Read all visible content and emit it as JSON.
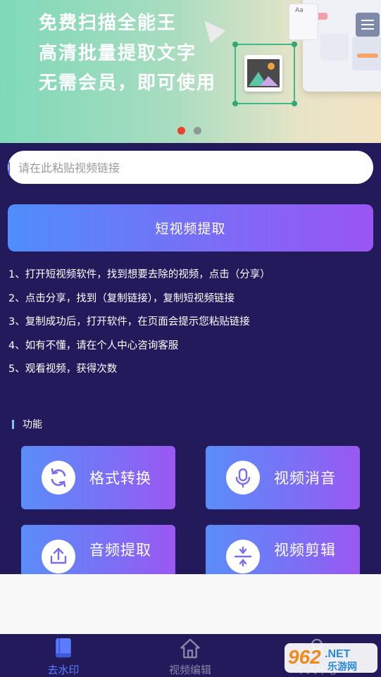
{
  "banner": {
    "lines": [
      "免费扫描全能王",
      "高清批量提取文字",
      "无需会员，即可使用"
    ],
    "dots": [
      {
        "color": "#e8452c"
      },
      {
        "color": "#8f9a92"
      }
    ]
  },
  "search": {
    "placeholder": "请在此粘贴视频链接",
    "value": ""
  },
  "extract_button": {
    "label": "短视频提取"
  },
  "steps": [
    "1、打开短视频软件，找到想要去除的视频，点击（分享）",
    "2、点击分享，找到（复制链接），复制短视频链接",
    "3、复制成功后，打开软件，在页面会提示您粘贴链接",
    "4、如有不懂，请在个人中心咨询客服",
    "5、观看视频，获得次数"
  ],
  "features": {
    "title": "功能",
    "items": [
      {
        "label": "格式转换",
        "icon": "refresh-icon"
      },
      {
        "label": "视频消音",
        "icon": "microphone-icon"
      },
      {
        "label": "音频提取",
        "icon": "upload-icon"
      },
      {
        "label": "视频剪辑",
        "icon": "compress-icon"
      }
    ]
  },
  "bottom_nav": {
    "items": [
      {
        "label": "去水印",
        "icon": "book-icon",
        "active": true
      },
      {
        "label": "视频编辑",
        "icon": "home-icon",
        "active": false
      },
      {
        "label": "个人中心",
        "icon": "person-icon",
        "active": false
      }
    ]
  },
  "watermark": {
    "text1": "962",
    "text2": ".NET",
    "text3": "乐游网"
  },
  "colors": {
    "accent": "#4f8dfb",
    "background": "#231a5c",
    "nav_active": "#5b7cff",
    "nav_inactive": "#8a86a8"
  }
}
